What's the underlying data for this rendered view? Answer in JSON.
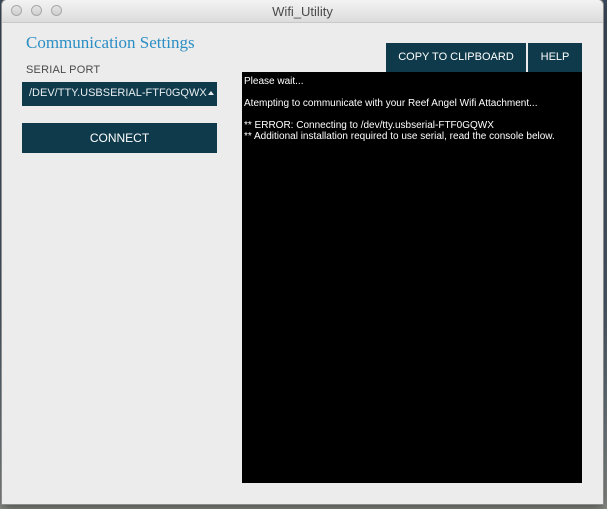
{
  "window": {
    "title": "Wifi_Utility"
  },
  "settings": {
    "heading": "Communication Settings",
    "serial_port_label": "SERIAL PORT",
    "serial_port_value": "/DEV/TTY.USBSERIAL-FTF0GQWX",
    "connect_label": "CONNECT"
  },
  "toolbar": {
    "copy_label": "COPY TO CLIPBOARD",
    "help_label": "HELP"
  },
  "console": {
    "line1": "Please wait...",
    "line2": "Atempting to communicate with your Reef Angel Wifi Attachment...",
    "line3": "** ERROR: Connecting to /dev/tty.usbserial-FTF0GQWX",
    "line4": "** Additional installation required to use serial, read the console below."
  },
  "colors": {
    "accent": "#2b8ec4",
    "button": "#0f3a4b",
    "console_bg": "#000000"
  }
}
